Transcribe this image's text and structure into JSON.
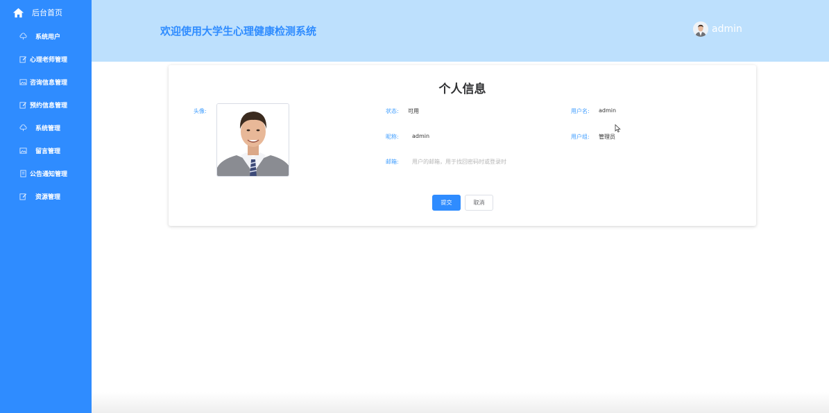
{
  "sidebar": {
    "home_label": "后台首页",
    "items": [
      {
        "label": "系统用户",
        "icon": "cloud-icon"
      },
      {
        "label": "心理老师管理",
        "icon": "edit-icon"
      },
      {
        "label": "咨询信息管理",
        "icon": "picture-icon"
      },
      {
        "label": "预约信息管理",
        "icon": "edit-icon"
      },
      {
        "label": "系统管理",
        "icon": "cloud-icon"
      },
      {
        "label": "留言管理",
        "icon": "picture-icon"
      },
      {
        "label": "公告通知管理",
        "icon": "document-icon"
      },
      {
        "label": "资源管理",
        "icon": "edit-icon"
      }
    ]
  },
  "header": {
    "title": "欢迎使用大学生心理健康检测系统",
    "username": "admin"
  },
  "profile": {
    "title": "个人信息",
    "avatar_label": "头像:",
    "status_label": "状态:",
    "status_value": "可用",
    "username_label": "用户名:",
    "username_value": "admin",
    "nickname_label": "昵称:",
    "nickname_value": "admin",
    "group_label": "用户组:",
    "group_value": "管理员",
    "email_label": "邮箱:",
    "email_placeholder": "用户的邮箱，用于找回密码时或登录时",
    "submit_label": "提交",
    "cancel_label": "取消"
  },
  "colors": {
    "sidebar_bg": "#2f8cff",
    "header_bg": "#bde0fd",
    "accent": "#2f8cff"
  }
}
